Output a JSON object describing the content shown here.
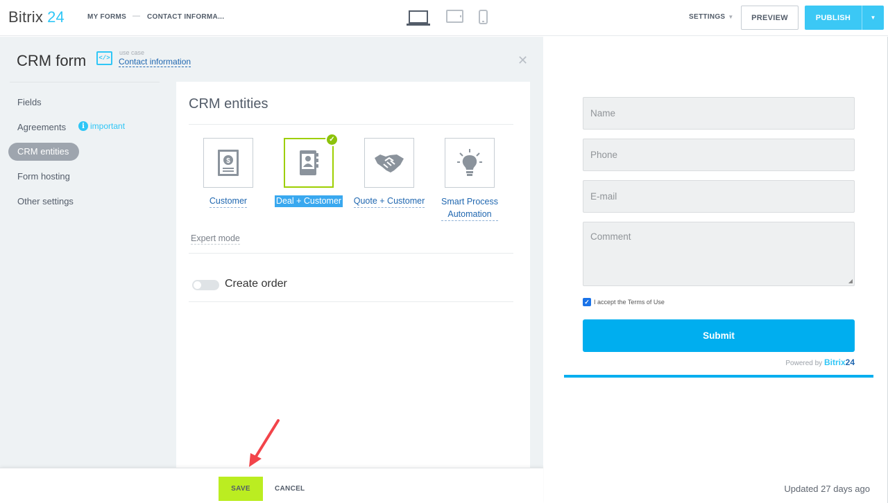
{
  "app": {
    "logo_word": "Bitrix",
    "logo_num": "24"
  },
  "header": {
    "breadcrumbs": [
      "MY FORMS",
      "CONTACT INFORMA..."
    ],
    "breadcrumb_separator": "—",
    "devices": [
      "laptop-icon",
      "tablet-icon",
      "phone-icon"
    ],
    "settings_label": "SETTINGS",
    "preview_label": "PREVIEW",
    "publish_label": "PUBLISH"
  },
  "form_panel": {
    "title": "CRM form",
    "use_case_label": "use case",
    "use_case_value": "Contact information",
    "sidebar": {
      "items": [
        {
          "label": "Fields",
          "active": false
        },
        {
          "label": "Agreements",
          "active": false,
          "badge": "important"
        },
        {
          "label": "CRM entities",
          "active": true
        },
        {
          "label": "Form hosting",
          "active": false
        },
        {
          "label": "Other settings",
          "active": false
        }
      ]
    },
    "section_title": "CRM entities",
    "entities": [
      {
        "label": "Customer",
        "icon": "invoice-icon",
        "selected": false
      },
      {
        "label": "Deal + Customer",
        "icon": "contact-book-icon",
        "selected": true
      },
      {
        "label": "Quote + Customer",
        "icon": "handshake-icon",
        "selected": false
      },
      {
        "label_line1": "Smart Process",
        "label_line2": "Automation",
        "icon": "lightbulb-icon",
        "selected": false
      }
    ],
    "expert_mode_label": "Expert mode",
    "create_order_label": "Create order",
    "create_order_enabled": false
  },
  "footer": {
    "save_label": "SAVE",
    "cancel_label": "CANCEL"
  },
  "preview": {
    "fields": [
      {
        "placeholder": "Name"
      },
      {
        "placeholder": "Phone"
      },
      {
        "placeholder": "E-mail"
      },
      {
        "placeholder": "Comment"
      }
    ],
    "terms_label": "I accept the Terms of Use",
    "terms_checked": true,
    "submit_label": "Submit",
    "powered_by_label": "Powered by",
    "powered_brand_1": "Bitrix",
    "powered_brand_2": "24",
    "updated_label": "Updated 27 days ago"
  },
  "colors": {
    "accent": "#2fc6f6",
    "publish": "#3bc8f5",
    "save": "#bbed21",
    "submit": "#00aeef",
    "selected_border": "#9dcf00",
    "arrow": "#f2444a"
  }
}
